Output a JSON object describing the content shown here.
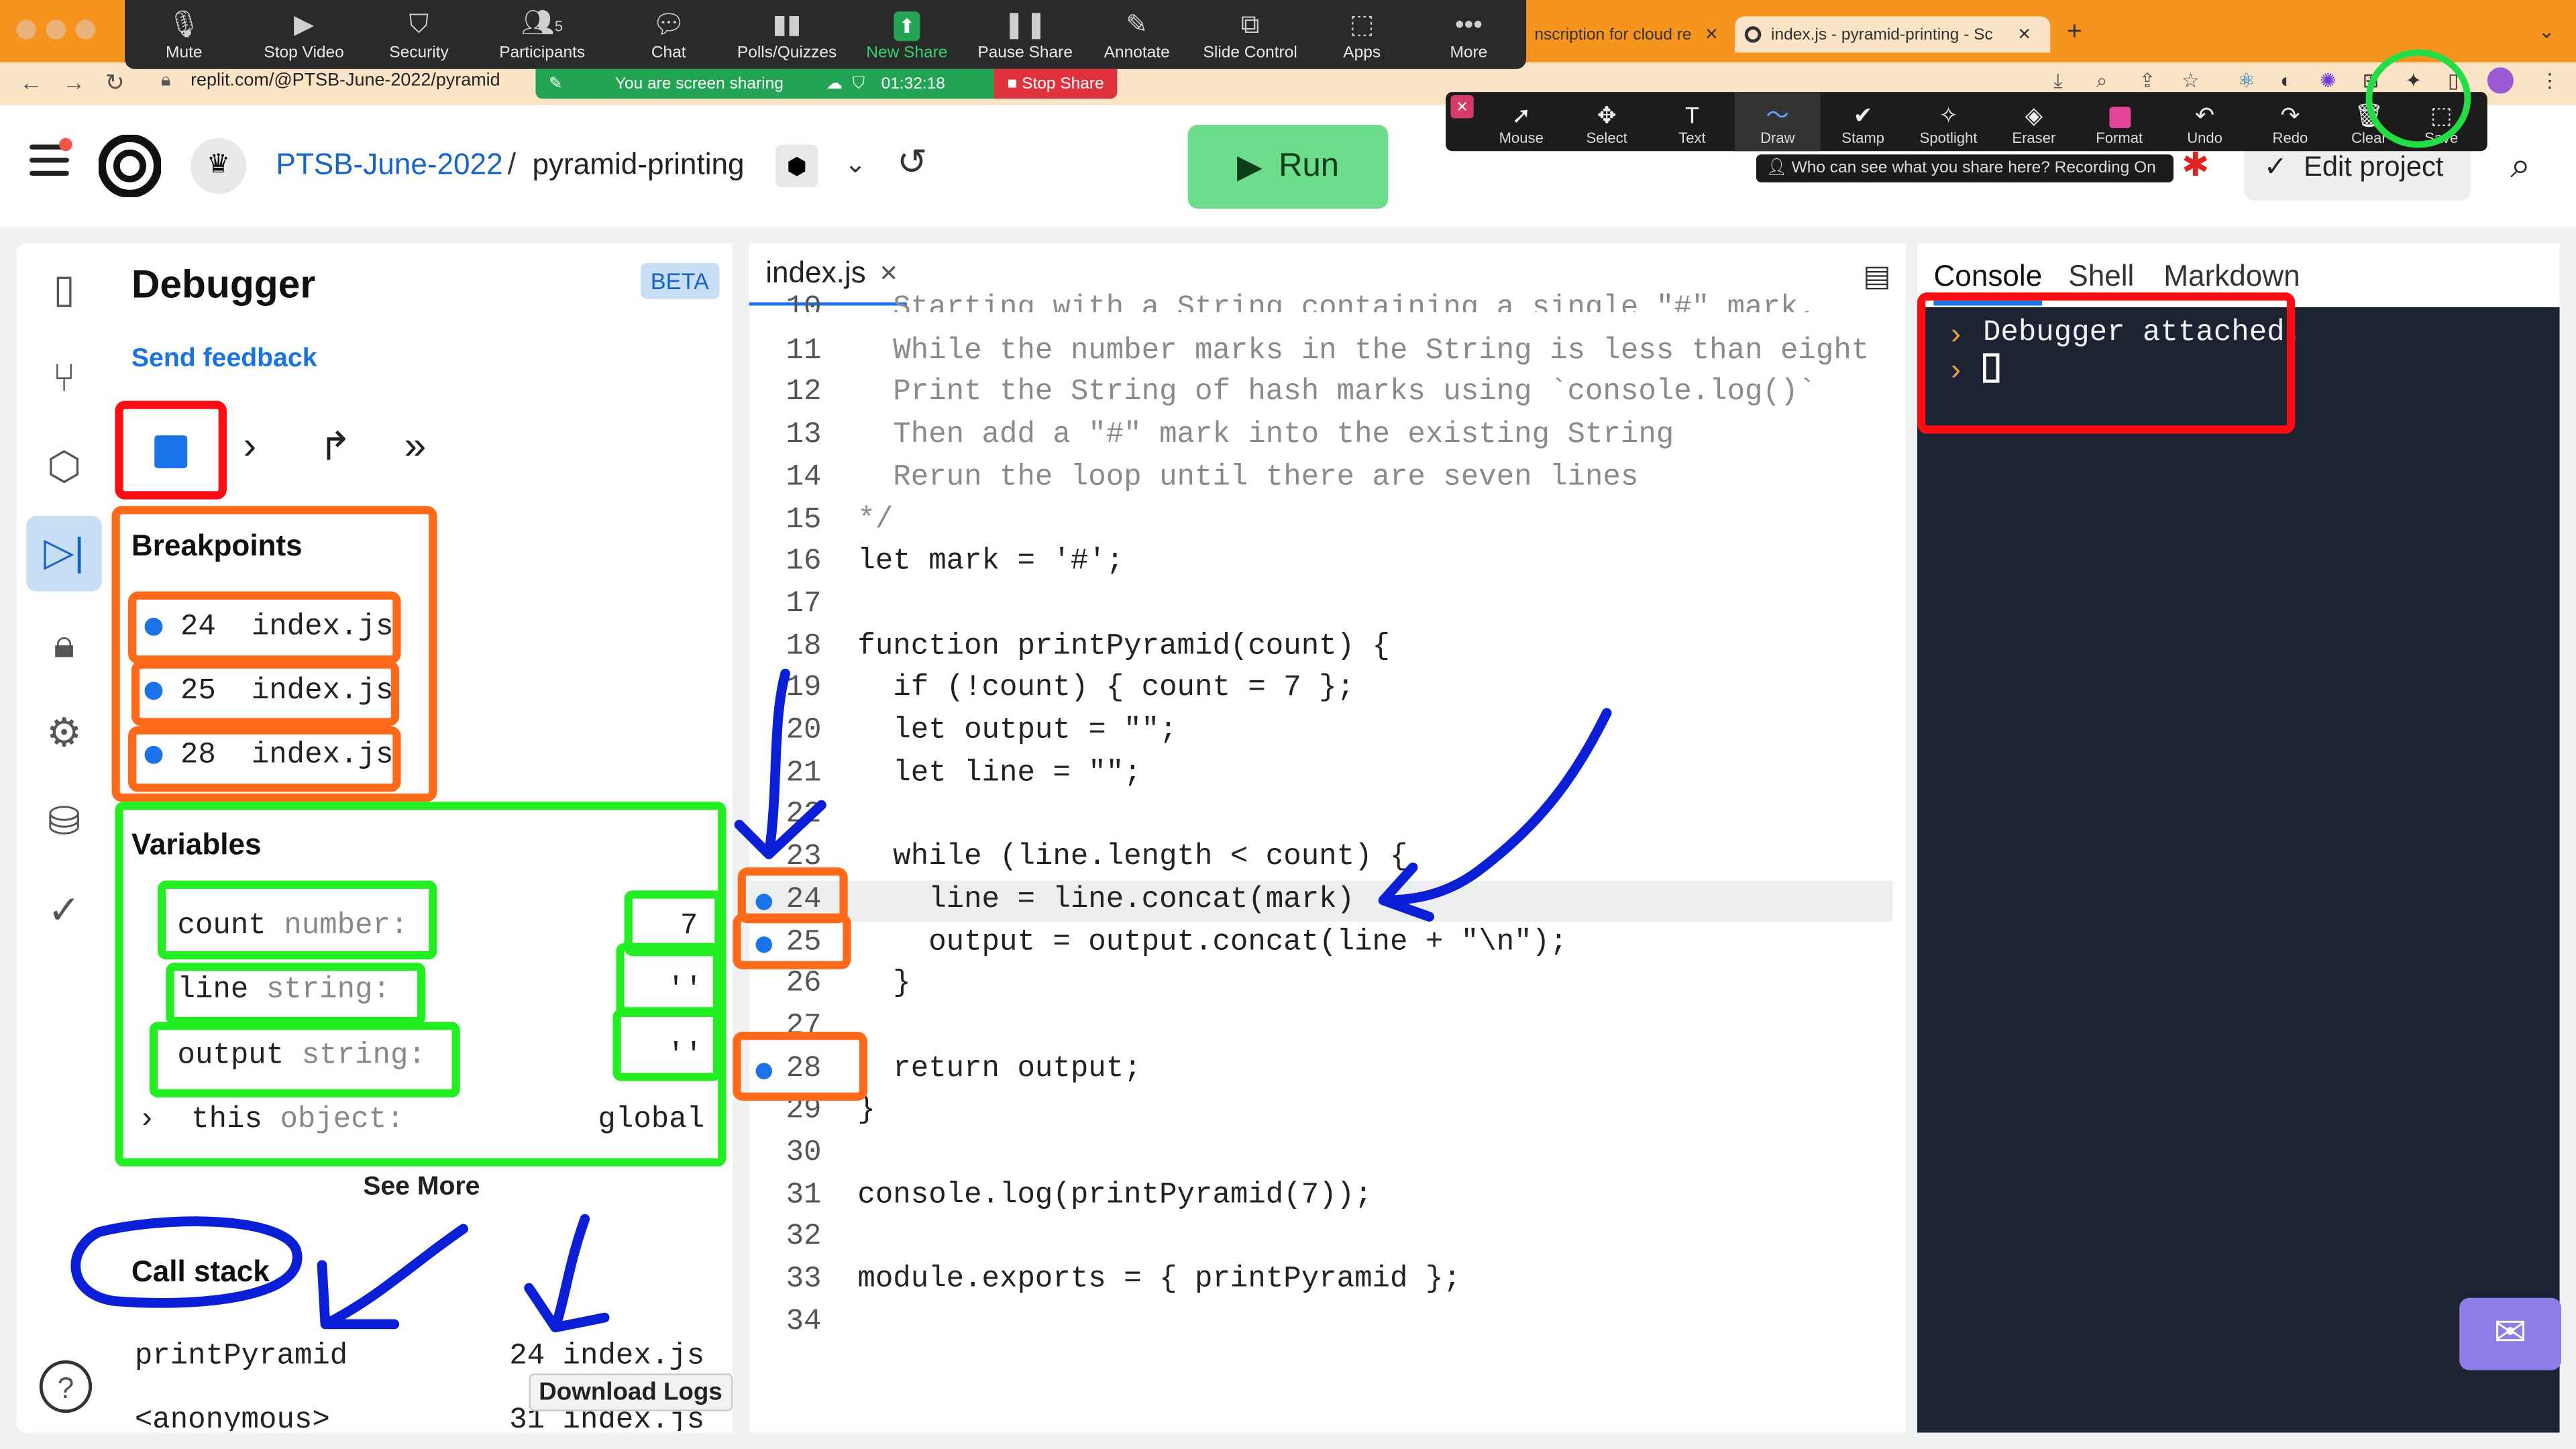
{
  "browser": {
    "tabs": [
      {
        "label": "nscription for cloud re"
      },
      {
        "label": "index.js - pyramid-printing - Sc"
      }
    ],
    "url": "replit.com/@PTSB-June-2022/pyramid"
  },
  "zoom_toolbar": {
    "items": [
      {
        "label": "Mute",
        "icon": "mic-icon"
      },
      {
        "label": "Stop Video",
        "icon": "video-icon"
      },
      {
        "label": "Security",
        "icon": "shield-icon"
      },
      {
        "label": "Participants",
        "icon": "people-icon",
        "count": "5"
      },
      {
        "label": "Chat",
        "icon": "chat-icon"
      },
      {
        "label": "Polls/Quizzes",
        "icon": "polls-icon"
      },
      {
        "label": "New Share",
        "icon": "share-icon"
      },
      {
        "label": "Pause Share",
        "icon": "pause-icon"
      },
      {
        "label": "Annotate",
        "icon": "pen-icon"
      },
      {
        "label": "Slide Control",
        "icon": "slide-icon"
      },
      {
        "label": "Apps",
        "icon": "apps-icon"
      },
      {
        "label": "More",
        "icon": "more-icon"
      }
    ],
    "sharing_text": "You are screen sharing",
    "timer": "01:32:18",
    "stop_share": "Stop Share"
  },
  "annotate_toolbar": {
    "items": [
      "Mouse",
      "Select",
      "Text",
      "Draw",
      "Stamp",
      "Spotlight",
      "Eraser",
      "Format",
      "Undo",
      "Redo",
      "Clear",
      "Save"
    ],
    "who_can_see": "Who can see what you share here? Recording On"
  },
  "header": {
    "breadcrumb_owner": "PTSB-June-2022",
    "separator": "/",
    "repl_name": "pyramid-printing",
    "run_label": "Run",
    "edit_project": "Edit project"
  },
  "debugger": {
    "title": "Debugger",
    "beta": "BETA",
    "feedback": "Send feedback",
    "breakpoints_title": "Breakpoints",
    "breakpoints": [
      {
        "line": "24",
        "file": "index.js"
      },
      {
        "line": "25",
        "file": "index.js"
      },
      {
        "line": "28",
        "file": "index.js"
      }
    ],
    "variables_title": "Variables",
    "variables": [
      {
        "name": "count",
        "type": "number:",
        "value": "7"
      },
      {
        "name": "line",
        "type": "string:",
        "value": "''"
      },
      {
        "name": "output",
        "type": "string:",
        "value": "''"
      },
      {
        "name": "this",
        "type": "object:",
        "value": "global"
      }
    ],
    "see_more": "See More",
    "callstack_title": "Call stack",
    "callstack": [
      {
        "fn": "printPyramid",
        "loc": "24  index.js"
      },
      {
        "fn": "<anonymous>",
        "loc": "31  index.js"
      }
    ],
    "download_logs": "Download Logs"
  },
  "editor": {
    "tab": "index.js",
    "lines": [
      {
        "n": "10",
        "t": "  Starting with a String containing a single \"#\" mark."
      },
      {
        "n": "11",
        "t": "  While the number marks in the String is less than eight"
      },
      {
        "n": "12",
        "t": "  Print the String of hash marks using `console.log()`"
      },
      {
        "n": "13",
        "t": "  Then add a \"#\" mark into the existing String"
      },
      {
        "n": "14",
        "t": "  Rerun the loop until there are seven lines"
      },
      {
        "n": "15",
        "t": "*/"
      },
      {
        "n": "16",
        "t": "let mark = '#';"
      },
      {
        "n": "17",
        "t": ""
      },
      {
        "n": "18",
        "t": "function printPyramid(count) {"
      },
      {
        "n": "19",
        "t": "  if (!count) { count = 7 };"
      },
      {
        "n": "20",
        "t": "  let output = \"\";"
      },
      {
        "n": "21",
        "t": "  let line = \"\";"
      },
      {
        "n": "22",
        "t": ""
      },
      {
        "n": "23",
        "t": "  while (line.length < count) {"
      },
      {
        "n": "24",
        "t": "    line = line.concat(mark)"
      },
      {
        "n": "25",
        "t": "    output = output.concat(line + \"\\n\");"
      },
      {
        "n": "26",
        "t": "  }"
      },
      {
        "n": "27",
        "t": ""
      },
      {
        "n": "28",
        "t": "  return output;"
      },
      {
        "n": "29",
        "t": "}"
      },
      {
        "n": "30",
        "t": ""
      },
      {
        "n": "31",
        "t": "console.log(printPyramid(7));"
      },
      {
        "n": "32",
        "t": ""
      },
      {
        "n": "33",
        "t": "module.exports = { printPyramid };"
      },
      {
        "n": "34",
        "t": ""
      }
    ]
  },
  "console": {
    "tabs": [
      "Console",
      "Shell",
      "Markdown"
    ],
    "output": "Debugger attached."
  },
  "colors": {
    "run_green": "#6ddc8b",
    "zoom_bg": "#2a2a2a",
    "breakpoint_blue": "#1a73e8",
    "console_bg": "#1c2333",
    "annotation_red": "#ff0b14",
    "annotation_orange": "#ff6a1a",
    "annotation_green": "#22ee22",
    "annotation_blue": "#0a1fd6"
  }
}
